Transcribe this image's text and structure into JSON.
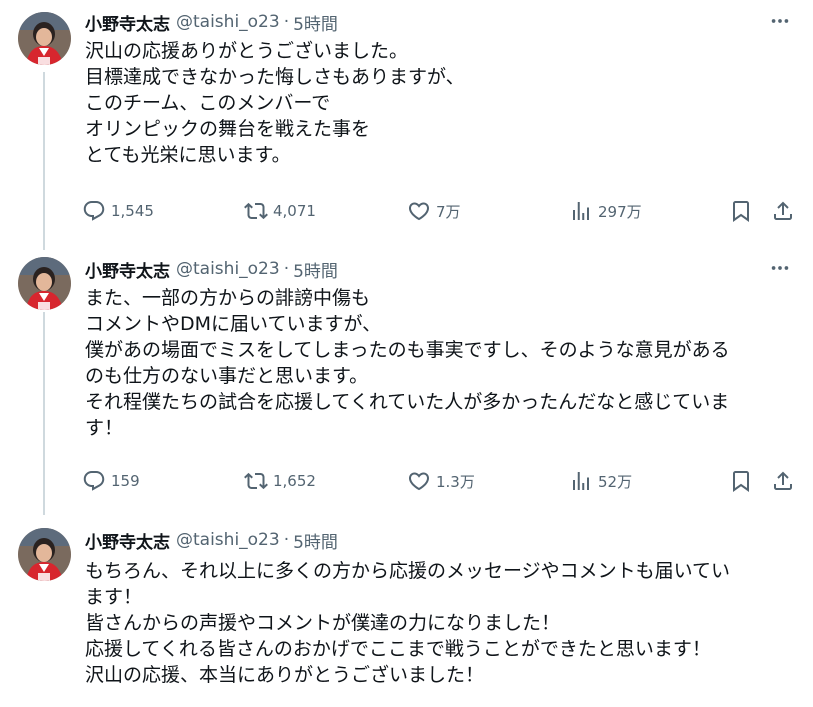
{
  "tweets": [
    {
      "name": "小野寺太志",
      "handle": "@taishi_o23",
      "separator": "·",
      "time": "5時間",
      "text": "沢山の応援ありがとうございました。\n目標達成できなかった悔しさもありますが、\nこのチーム、このメンバーで\nオリンピックの舞台を戦えた事を\nとても光栄に思います。",
      "replies": "1,545",
      "retweets": "4,071",
      "likes": "7万",
      "views": "297万"
    },
    {
      "name": "小野寺太志",
      "handle": "@taishi_o23",
      "separator": "·",
      "time": "5時間",
      "text": "また、一部の方からの誹謗中傷も\nコメントやDMに届いていますが、\n僕があの場面でミスをしてしまったのも事実ですし、そのような意見がある\nのも仕方のない事だと思います。\nそれ程僕たちの試合を応援してくれていた人が多かったんだなと感じていま\nす！",
      "replies": "159",
      "retweets": "1,652",
      "likes": "1.3万",
      "views": "52万"
    },
    {
      "name": "小野寺太志",
      "handle": "@taishi_o23",
      "separator": "·",
      "time": "5時間",
      "text": "もちろん、それ以上に多くの方から応援のメッセージやコメントも届いてい\nます！\n皆さんからの声援やコメントが僕達の力になりました！\n応援してくれる皆さんのおかげでここまで戦うことができたと思います！\n沢山の応援、本当にありがとうございました！"
    }
  ],
  "icons": {
    "reply": "reply-icon",
    "retweet": "retweet-icon",
    "like": "heart-icon",
    "views": "views-icon",
    "bookmark": "bookmark-icon",
    "share": "share-icon",
    "more": "more-icon"
  },
  "colors": {
    "text": "#0f1419",
    "secondary": "#536471",
    "thread_line": "#cfd9de",
    "jersey_red": "#d7262e"
  }
}
